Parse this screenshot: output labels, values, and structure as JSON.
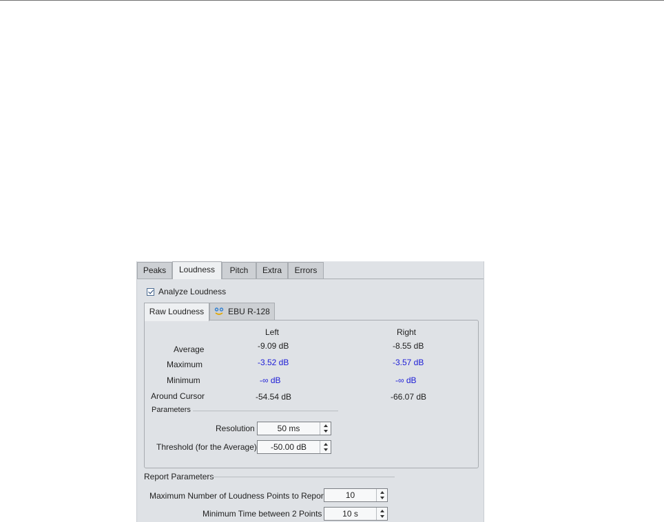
{
  "tabs": [
    "Peaks",
    "Loudness",
    "Pitch",
    "Extra",
    "Errors"
  ],
  "active_tab": "Loudness",
  "analyze": {
    "label": "Analyze Loudness",
    "checked": true
  },
  "subtabs": {
    "raw": "Raw Loudness",
    "ebu": "EBU R-128"
  },
  "columns": {
    "left": "Left",
    "right": "Right"
  },
  "rows": [
    {
      "label": "Average",
      "left": "-9.09 dB",
      "right": "-8.55 dB"
    },
    {
      "label": "Maximum",
      "left": "-3.52 dB",
      "right": "-3.57 dB"
    },
    {
      "label": "Minimum",
      "left": "-∞ dB",
      "right": "-∞ dB"
    },
    {
      "label": "Around Cursor",
      "left": "-54.54 dB",
      "right": "-66.07 dB"
    }
  ],
  "parameters": {
    "title": "Parameters",
    "resolution_label": "Resolution",
    "resolution_value": "50 ms",
    "threshold_label": "Threshold (for the Average)",
    "threshold_value": "-50.00 dB"
  },
  "report": {
    "title": "Report Parameters",
    "max_points_label": "Maximum Number of Loudness Points to Report",
    "max_points_value": "10",
    "min_time_label": "Minimum Time between 2 Points",
    "min_time_value": "10 s"
  },
  "colors": {
    "panel_bg": "#dfe2e6",
    "active_value": "#1b1bd6"
  }
}
